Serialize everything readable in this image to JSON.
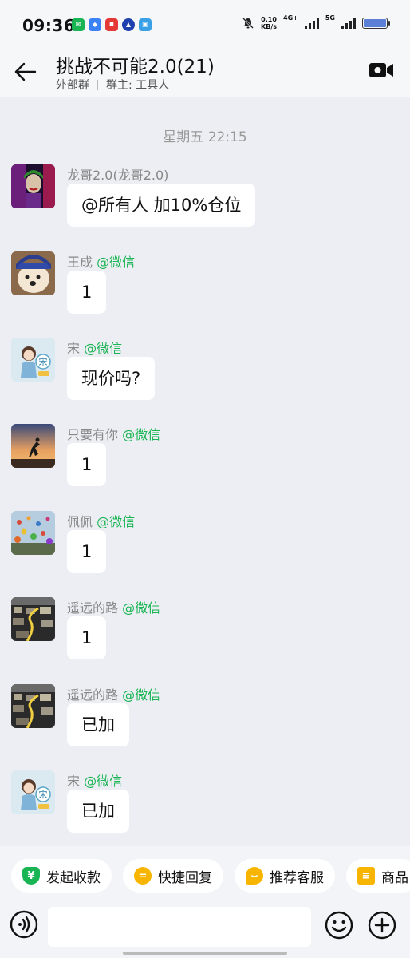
{
  "status_bar": {
    "time": "09:36",
    "speed_value": "0.10",
    "speed_unit": "KB/s",
    "network_1": "4G+",
    "network_2": "5G"
  },
  "header": {
    "title": "挑战不可能2.0(21)",
    "group_type": "外部群",
    "group_owner": "群主: 工具人"
  },
  "timestamp": "星期五  22:15",
  "messages": [
    {
      "sender": "龙哥2.0(龙哥2.0)",
      "source": "",
      "text": "@所有人 加10%仓位",
      "avatar": "avatar-joker"
    },
    {
      "sender": "王成 ",
      "source": "@微信",
      "text": "1",
      "avatar": "avatar-dog"
    },
    {
      "sender": "宋 ",
      "source": "@微信",
      "text": "现价吗?",
      "avatar": "avatar-girl"
    },
    {
      "sender": "只要有你 ",
      "source": "@微信",
      "text": "1",
      "avatar": "avatar-sunset"
    },
    {
      "sender": "佩佩 ",
      "source": "@微信",
      "text": "1",
      "avatar": "avatar-balloons"
    },
    {
      "sender": "遥远的路 ",
      "source": "@微信",
      "text": "1",
      "avatar": "avatar-city"
    },
    {
      "sender": "遥远的路 ",
      "source": "@微信",
      "text": "已加",
      "avatar": "avatar-city"
    },
    {
      "sender": "宋 ",
      "source": "@微信",
      "text": "已加",
      "avatar": "avatar-girl"
    }
  ],
  "quick_actions": [
    {
      "label": "发起收款",
      "icon": "yuan-shield-icon"
    },
    {
      "label": "快捷回复",
      "icon": "quick-reply-icon"
    },
    {
      "label": "推荐客服",
      "icon": "recommend-service-icon"
    },
    {
      "label": "商品",
      "icon": "product-icon"
    }
  ],
  "input": {
    "placeholder": ""
  },
  "avatar_text": {
    "girl": "宋"
  },
  "colors": {
    "wechat_green": "#19b453",
    "accent_yellow": "#f7b500",
    "background": "#eceef3"
  }
}
